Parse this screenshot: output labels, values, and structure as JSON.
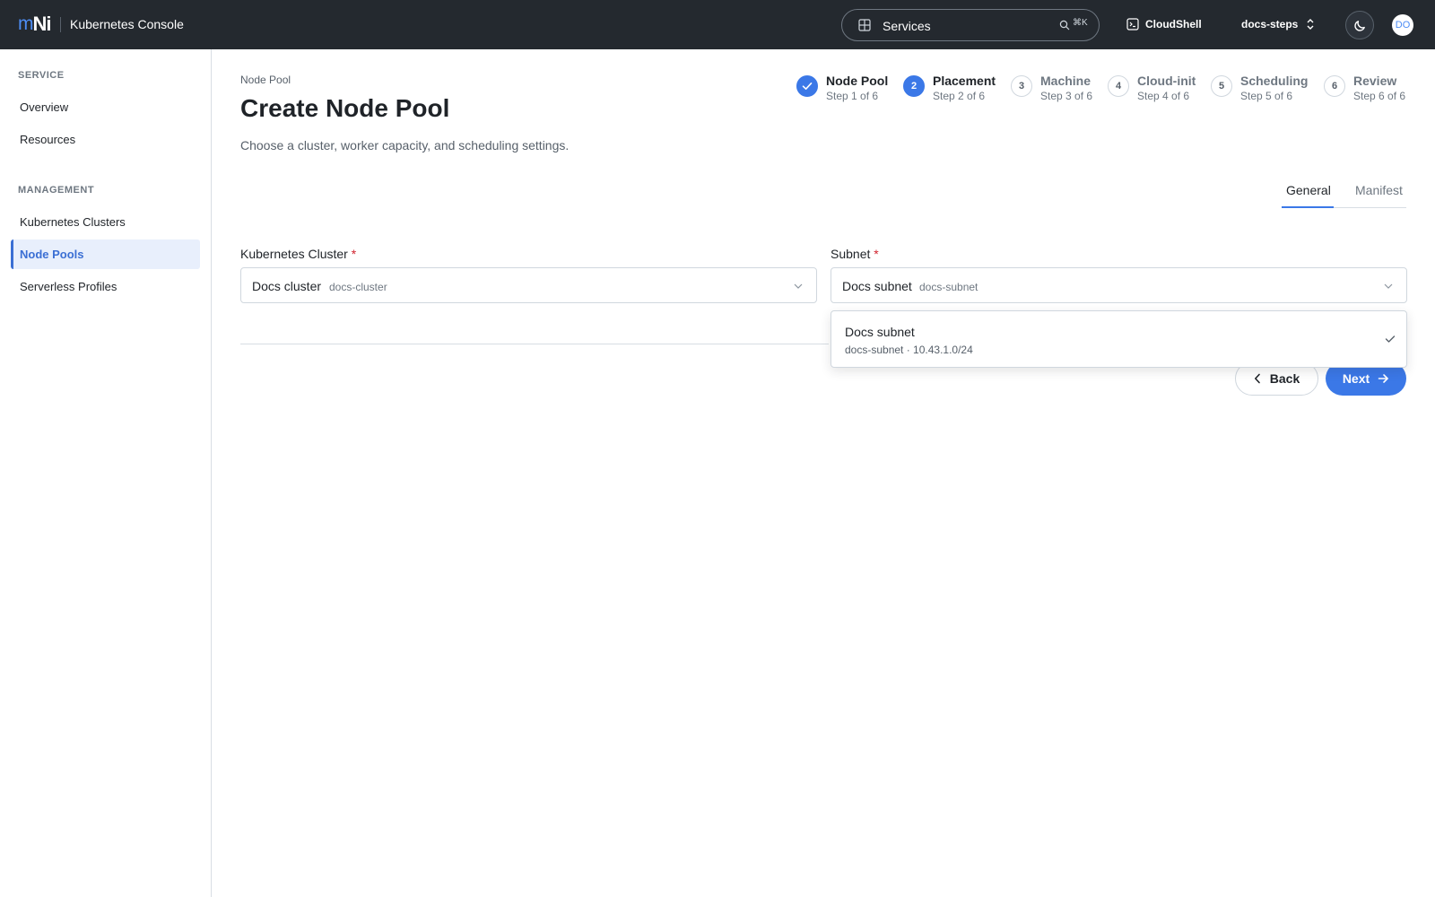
{
  "header": {
    "logo_m": "m",
    "logo_n": "Ni",
    "app_title": "Kubernetes Console",
    "search_label": "Services",
    "search_shortcut": "⌘K",
    "cloudshell_label": "CloudShell",
    "project_label": "docs-steps",
    "avatar_initials": "DO",
    "icons": [
      "grid-icon",
      "search-icon",
      "terminal-icon",
      "chevron-up-down-icon",
      "moon-icon"
    ]
  },
  "sidebar": {
    "sections": [
      {
        "title": "SERVICE",
        "items": [
          {
            "label": "Overview",
            "active": false
          },
          {
            "label": "Resources",
            "active": false
          }
        ]
      },
      {
        "title": "MANAGEMENT",
        "items": [
          {
            "label": "Kubernetes Clusters",
            "active": false
          },
          {
            "label": "Node Pools",
            "active": true
          },
          {
            "label": "Serverless Profiles",
            "active": false
          }
        ]
      }
    ]
  },
  "page": {
    "breadcrumb": "Node Pool",
    "title": "Create Node Pool",
    "description": "Choose a cluster, worker capacity, and scheduling settings."
  },
  "stepper": {
    "steps": [
      {
        "number": "1",
        "label": "Node Pool",
        "sub": "Step 1 of 6",
        "state": "done"
      },
      {
        "number": "2",
        "label": "Placement",
        "sub": "Step 2 of 6",
        "state": "current"
      },
      {
        "number": "3",
        "label": "Machine",
        "sub": "Step 3 of 6",
        "state": "upcoming"
      },
      {
        "number": "4",
        "label": "Cloud-init",
        "sub": "Step 4 of 6",
        "state": "upcoming"
      },
      {
        "number": "5",
        "label": "Scheduling",
        "sub": "Step 5 of 6",
        "state": "upcoming"
      },
      {
        "number": "6",
        "label": "Review",
        "sub": "Step 6 of 6",
        "state": "upcoming"
      }
    ]
  },
  "tabs": [
    {
      "label": "General",
      "active": true
    },
    {
      "label": "Manifest",
      "active": false
    }
  ],
  "form": {
    "cluster": {
      "label": "Kubernetes Cluster",
      "required_mark": "*",
      "value": "Docs cluster",
      "meta": "docs-cluster"
    },
    "subnet": {
      "label": "Subnet",
      "required_mark": "*",
      "value": "Docs subnet",
      "meta": "docs-subnet"
    }
  },
  "dropdown": {
    "options": [
      {
        "title": "Docs subnet",
        "subtitle": "docs-subnet · 10.43.1.0/24",
        "selected": true
      }
    ]
  },
  "actions": {
    "back_label": "Back",
    "next_label": "Next"
  },
  "colors": {
    "accent": "#3b78e7",
    "topbar": "#24292f",
    "required": "#d1242f"
  }
}
